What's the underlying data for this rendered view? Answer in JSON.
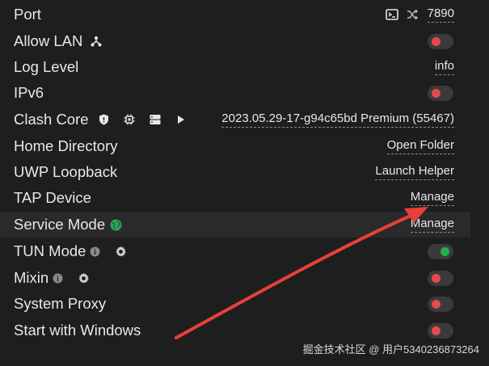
{
  "settings": {
    "port": {
      "label": "Port",
      "value": "7890",
      "terminal_icon": "terminal-icon",
      "shuffle_icon": "shuffle-icon"
    },
    "allow_lan": {
      "label": "Allow LAN",
      "icon": "network-icon",
      "state": "off"
    },
    "log_level": {
      "label": "Log Level",
      "value": "info"
    },
    "ipv6": {
      "label": "IPv6",
      "state": "off"
    },
    "clash_core": {
      "label": "Clash Core",
      "value": "2023.05.29-17-g94c65bd Premium (55467)",
      "icons": [
        "shield-icon",
        "chip-icon",
        "server-icon",
        "play-icon"
      ]
    },
    "home_directory": {
      "label": "Home Directory",
      "action": "Open Folder"
    },
    "uwp_loopback": {
      "label": "UWP Loopback",
      "action": "Launch Helper"
    },
    "tap_device": {
      "label": "TAP Device",
      "action": "Manage"
    },
    "service_mode": {
      "label": "Service Mode",
      "action": "Manage",
      "status_icon": "globe-icon",
      "status_color": "#2fa55a"
    },
    "tun_mode": {
      "label": "TUN Mode",
      "state": "on",
      "info_icon": "info-icon",
      "settings_icon": "gear-icon"
    },
    "mixin": {
      "label": "Mixin",
      "state": "off",
      "info_icon": "info-icon",
      "settings_icon": "gear-icon"
    },
    "system_proxy": {
      "label": "System Proxy",
      "state": "off"
    },
    "start_with_windows": {
      "label": "Start with Windows",
      "state": "off"
    }
  },
  "colors": {
    "background": "#1e1e1e",
    "toggle_off_knob": "#e04c4c",
    "toggle_on_knob": "#22b24c",
    "annotation_arrow": "#e8403a"
  },
  "watermark": "掘金技术社区 @ 用户5340236873264"
}
